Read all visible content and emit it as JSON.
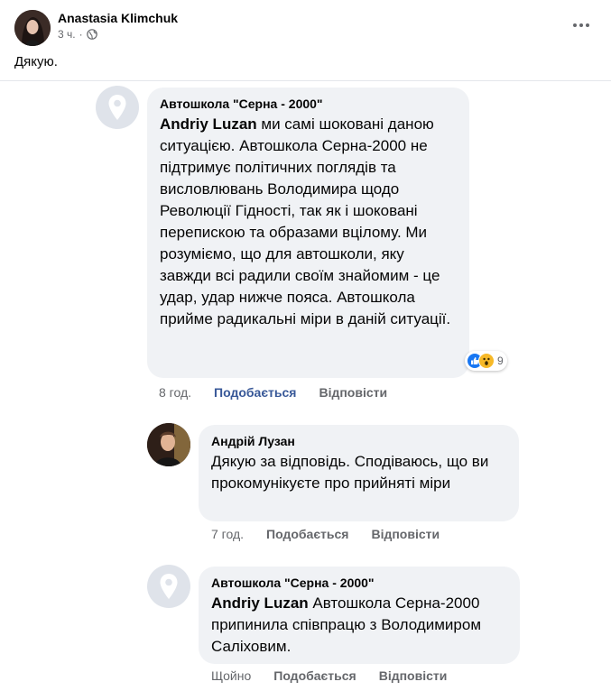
{
  "post": {
    "author": "Anastasia Klimchuk",
    "time": "3 ч.",
    "separator": "·",
    "text": "Дякую."
  },
  "comments": [
    {
      "author": "Автошкола \"Серна - 2000\"",
      "mention": "Andriy Luzan",
      "text": " ми самі шоковані даною ситуацією. Автошкола Серна-2000 не підтримує політичних поглядів та висловлювань Володимира щодо Революції Гідності, так як і шоковані перепискою та образами вцілому. Ми розуміємо, що для автошколи, яку завжди всі радили своїм знайомим - це удар, удар нижче пояса. Автошкола прийме радикальні міри в даній ситуації.",
      "time": "8 год.",
      "like_label": "Подобається",
      "reply_label": "Відповісти",
      "reaction_count": "9",
      "reaction_icons": [
        "like-icon",
        "wow-icon"
      ]
    },
    {
      "author": "Андрій Лузан",
      "text": "Дякую за відповідь. Сподіваюсь, що ви прокомунікуєте про прийняті міри",
      "time": "7 год.",
      "like_label": "Подобається",
      "reply_label": "Відповісти"
    },
    {
      "author": "Автошкола \"Серна - 2000\"",
      "mention": "Andriy Luzan",
      "text": " Автошкола Серна-2000 припинила співпрацю з Володимиром Саліховим.",
      "time": "Щойно",
      "like_label": "Подобається",
      "reply_label": "Відповісти"
    }
  ],
  "colors": {
    "bubble": "#f0f2f5",
    "meta": "#65676b",
    "liked": "#385898",
    "like_reaction": "#1877f2",
    "wow_reaction": "#f7b928"
  }
}
